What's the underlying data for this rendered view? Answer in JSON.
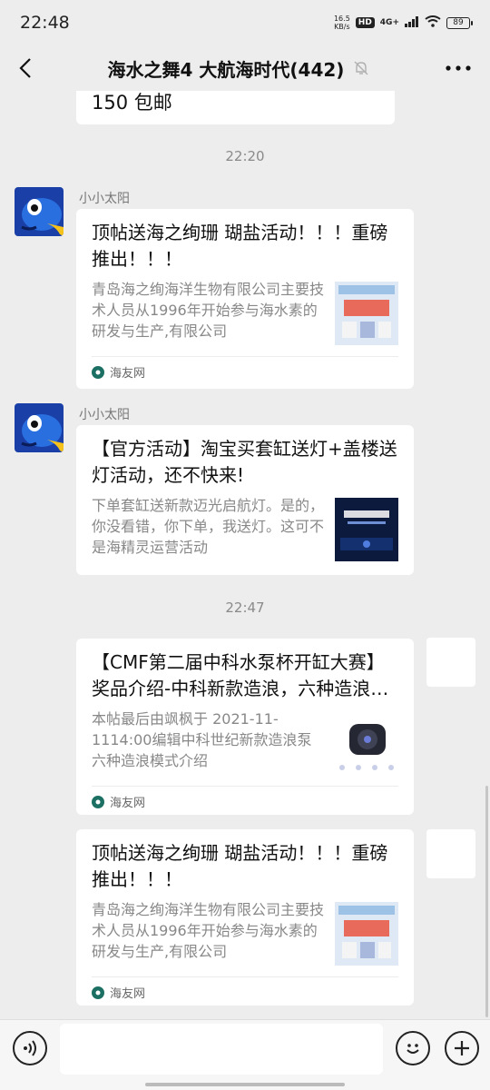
{
  "status_bar": {
    "time": "22:48",
    "net_speed_value": "16.5",
    "net_speed_unit": "KB/s",
    "hd": "HD",
    "network": "4G+",
    "battery": "89"
  },
  "nav": {
    "title": "海水之舞4 大航海时代(442)",
    "back_icon": "back-arrow-icon",
    "muted_icon": "bell-off-icon",
    "more_icon": "more-dots-icon"
  },
  "chat": {
    "partial_text": "150 包邮",
    "timestamps": [
      "22:20",
      "22:47"
    ],
    "messages": [
      {
        "sender": "小小太阳",
        "title": "顶帖送海之绚珊 瑚盐活动！！！重磅推出！！！",
        "desc": "青岛海之绚海洋生物有限公司主要技术人员从1996年开始参与海水素的研发与生产,有限公司",
        "source": "海友网"
      },
      {
        "sender": "小小太阳",
        "title": "【官方活动】淘宝买套缸送灯+盖楼送灯活动，还不快来!",
        "desc": "下单套缸送新款迈光启航灯。是的，你没看错，你下单，我送灯。这可不是海精灵运营活动",
        "source": ""
      },
      {
        "sender": "",
        "title": "【CMF第二届中科水泵杯开缸大赛】奖品介绍-中科新款造浪，六种造浪模式",
        "desc": "本帖最后由飒枫于 2021-11-1114:00编辑中科世纪新款造浪泵六种造浪模式介绍",
        "source": "海友网"
      },
      {
        "sender": "",
        "title": "顶帖送海之绚珊 瑚盐活动！！！重磅推出！！！",
        "desc": "青岛海之绚海洋生物有限公司主要技术人员从1996年开始参与海水素的研发与生产,有限公司",
        "source": "海友网"
      }
    ]
  },
  "input_bar": {
    "voice_icon": "voice-icon",
    "emoji_icon": "emoji-icon",
    "plus_icon": "plus-icon",
    "input_value": ""
  },
  "colors": {
    "background": "#ededed",
    "bubble": "#ffffff",
    "source_icon": "#1b6f63"
  }
}
